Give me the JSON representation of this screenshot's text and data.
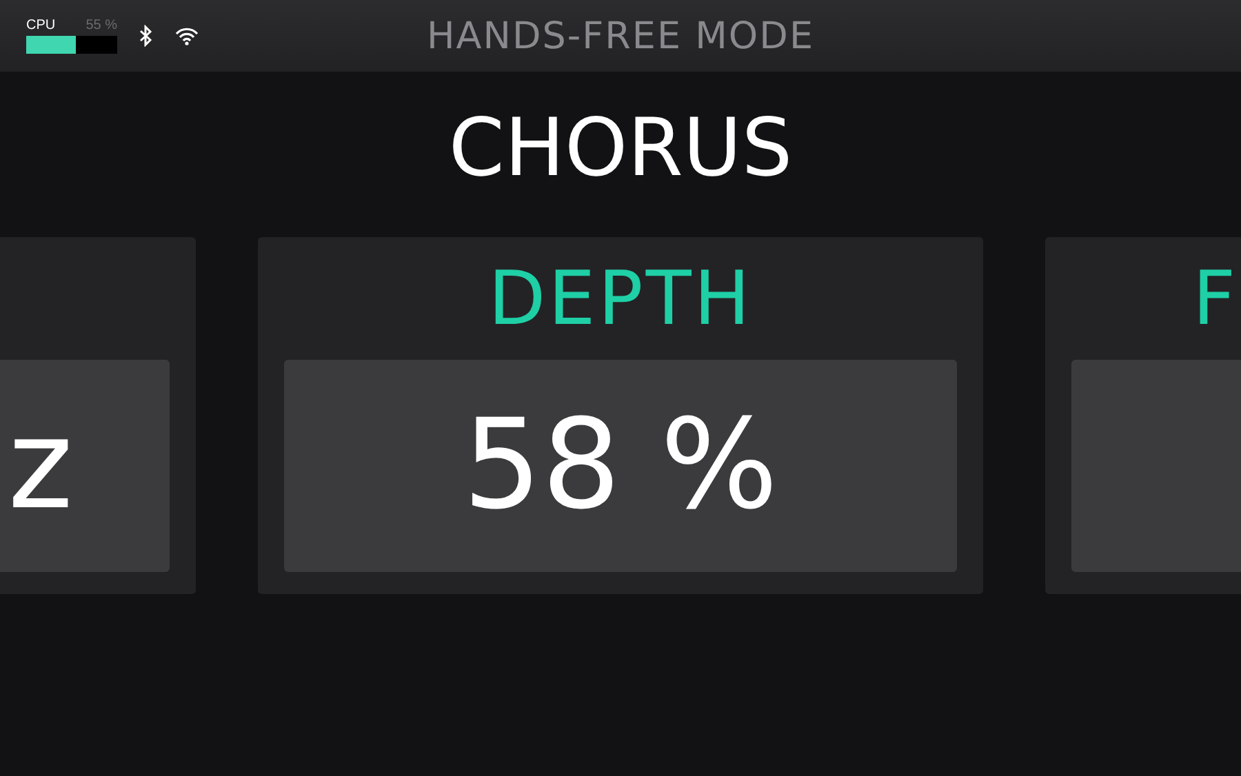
{
  "status_bar": {
    "cpu_label": "CPU",
    "cpu_reading": "55 %",
    "cpu_meter": {
      "level": 0.55
    },
    "title": "HANDS-FREE MODE"
  },
  "effect_name": "CHORUS",
  "cards": [
    {
      "kind": "left",
      "value": "z"
    },
    {
      "kind": "center",
      "label": "DEPTH",
      "value": "58 %"
    },
    {
      "kind": "right",
      "label": "F"
    }
  ]
}
